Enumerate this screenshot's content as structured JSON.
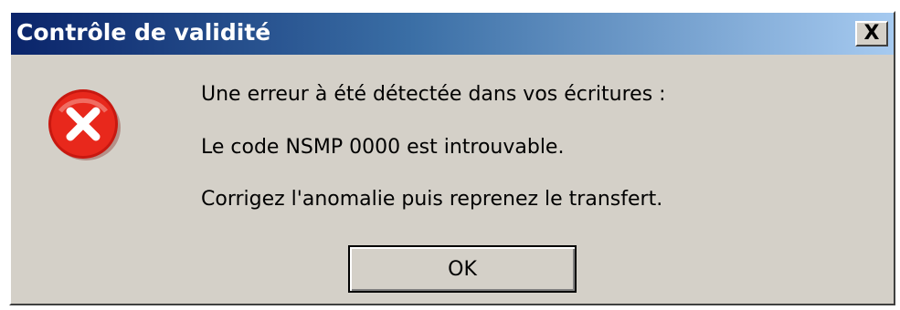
{
  "dialog": {
    "title": "Contrôle de validité",
    "close_label": "X",
    "icon": "error-icon",
    "messages": [
      "Une erreur à été détectée dans vos écritures :",
      "Le code NSMP 0000 est introuvable.",
      "Corrigez l'anomalie puis reprenez le transfert."
    ],
    "ok_label": "OK"
  },
  "colors": {
    "titlebar_start": "#0a246a",
    "titlebar_end": "#a6caf0",
    "dialog_bg": "#d4d0c8",
    "error_red": "#e8281c"
  }
}
